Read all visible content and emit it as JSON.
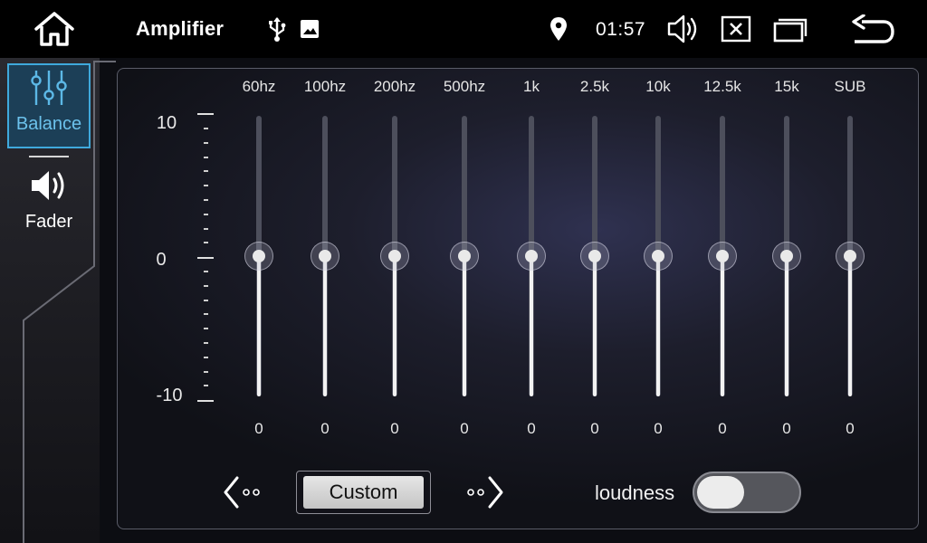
{
  "topbar": {
    "title": "Amplifier",
    "clock": "01:57",
    "icons": [
      "home-icon",
      "usb-icon",
      "image-icon",
      "location-icon",
      "volume-icon",
      "close-app-icon",
      "recents-icon",
      "back-icon"
    ]
  },
  "sidebar": {
    "items": [
      {
        "label": "Balance",
        "icon": "equalizer-sliders-icon",
        "active": true
      },
      {
        "label": "Fader",
        "icon": "speaker-icon",
        "active": false
      }
    ]
  },
  "equalizer": {
    "scale": {
      "max": "10",
      "mid": "0",
      "min": "-10"
    },
    "bands": [
      {
        "label": "60hz",
        "value": 0
      },
      {
        "label": "100hz",
        "value": 0
      },
      {
        "label": "200hz",
        "value": 0
      },
      {
        "label": "500hz",
        "value": 0
      },
      {
        "label": "1k",
        "value": 0
      },
      {
        "label": "2.5k",
        "value": 0
      },
      {
        "label": "10k",
        "value": 0
      },
      {
        "label": "12.5k",
        "value": 0
      },
      {
        "label": "15k",
        "value": 0
      },
      {
        "label": "SUB",
        "value": 0
      }
    ]
  },
  "controls": {
    "preset_label": "Custom",
    "loudness_label": "loudness",
    "loudness_on": false
  },
  "colors": {
    "accent": "#3fa9dc",
    "active_bg": "#1c3f57"
  }
}
